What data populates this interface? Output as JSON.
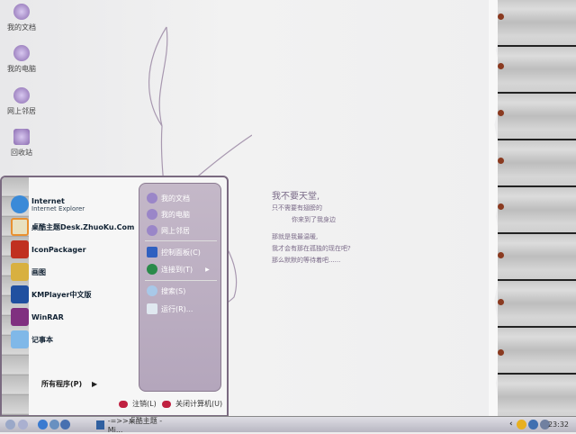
{
  "desktop": {
    "icons": [
      {
        "label": "我的文档"
      },
      {
        "label": "我的电脑"
      },
      {
        "label": "网上邻居"
      },
      {
        "label": "回收站"
      }
    ],
    "poem": [
      "我不要天堂,",
      "只不需要有翅膀的",
      "你来到了我身边",
      "那就是我最温暖,",
      "我才会有那在孤独的现在吧?",
      "那么默默的等待着吧......"
    ]
  },
  "start_menu": {
    "pinned": [
      {
        "title": "Internet",
        "subtitle": "Internet Explorer"
      },
      {
        "title": "桌酷主题Desk.ZhuoKu.Com"
      },
      {
        "title": "IconPackager"
      },
      {
        "title": "画图"
      },
      {
        "title": "KMPlayer中文版"
      },
      {
        "title": "WinRAR"
      },
      {
        "title": "记事本"
      }
    ],
    "all_programs": "所有程序(P)",
    "right": [
      {
        "label": "我的文档"
      },
      {
        "label": "我的电脑"
      },
      {
        "label": "网上邻居"
      },
      {
        "label": "控制面板(C)"
      },
      {
        "label": "连接到(T)"
      },
      {
        "label": "搜索(S)"
      },
      {
        "label": "运行(R)..."
      }
    ],
    "logoff": "注销(L)",
    "shutdown": "关闭计算机(U)"
  },
  "taskbar": {
    "task": "-=>>桌酷主题 - Mi...",
    "clock": "23:32"
  },
  "colors": {
    "accent": "#7a6a80",
    "panel": "#b8aac0"
  }
}
